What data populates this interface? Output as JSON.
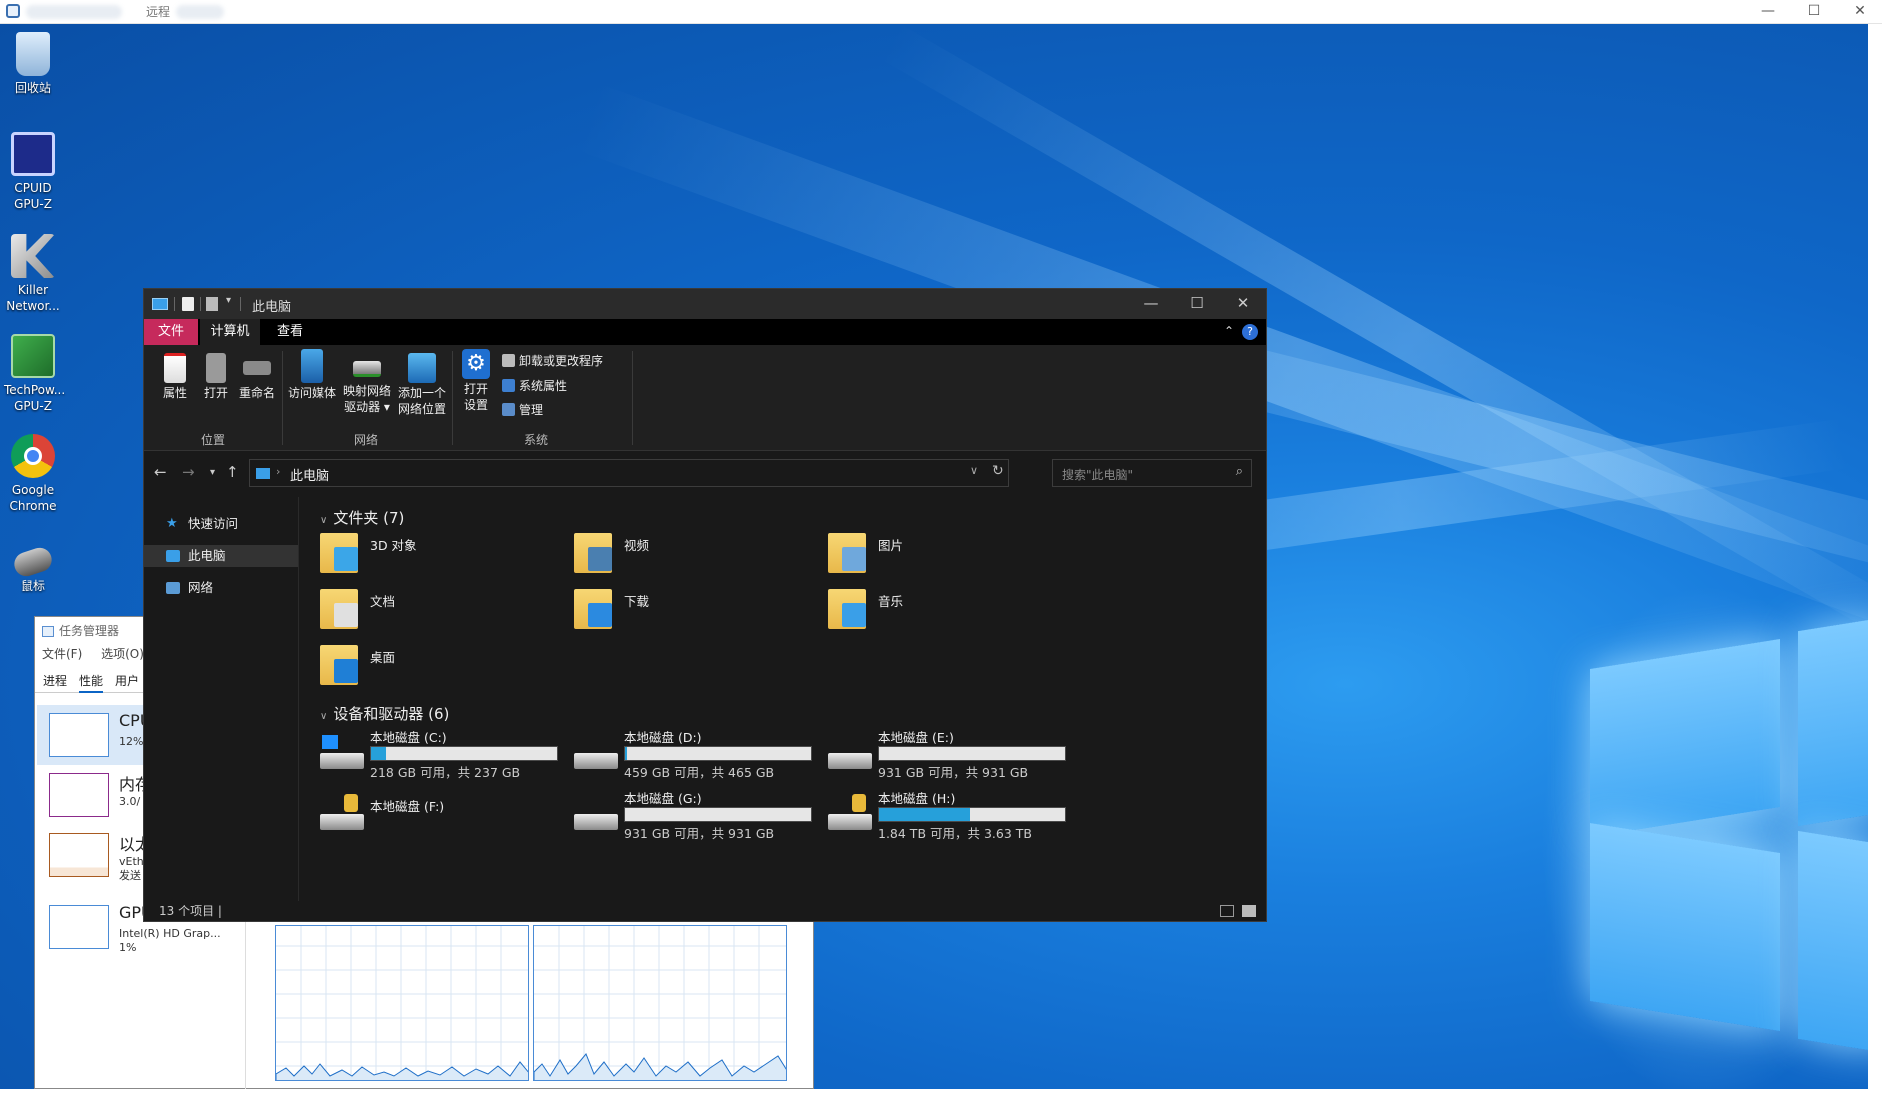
{
  "remote_window": {
    "title": "远程",
    "min": "—",
    "max": "☐",
    "close": "✕"
  },
  "desktop_icons": [
    {
      "label": "回收站"
    },
    {
      "label": "CPUID GPU-Z"
    },
    {
      "label": "Killer Networ..."
    },
    {
      "label": "TechPow... GPU-Z"
    },
    {
      "label": "Google Chrome"
    },
    {
      "label": "鼠标"
    }
  ],
  "task_manager": {
    "title": "任务管理器",
    "menu": [
      "文件(F)",
      "选项(O)"
    ],
    "tabs": [
      "进程",
      "性能",
      "用户"
    ],
    "items": [
      {
        "name": "CPU",
        "line1": "12%",
        "line2": ""
      },
      {
        "name": "内存",
        "line1": "3.0/",
        "line2": ""
      },
      {
        "name": "以太",
        "line1": "vEth",
        "line2": "发送"
      },
      {
        "name": "GPU",
        "line1": "Intel(R) HD Grap...",
        "line2": "1%"
      }
    ]
  },
  "explorer": {
    "title": "此电脑",
    "tabs": [
      "文件",
      "计算机",
      "查看"
    ],
    "ribbon": {
      "location": {
        "group": "位置",
        "properties": "属性",
        "open": "打开",
        "rename": "重命名"
      },
      "network": {
        "group": "网络",
        "media": "访问媒体",
        "map_drive_1": "映射网络",
        "map_drive_2": "驱动器 ▾",
        "add_loc_1": "添加一个",
        "add_loc_2": "网络位置"
      },
      "system": {
        "group": "系统",
        "settings_1": "打开",
        "settings_2": "设置",
        "uninstall": "卸载或更改程序",
        "sys_props": "系统属性",
        "manage": "管理"
      }
    },
    "address": {
      "crumb": "此电脑",
      "search_placeholder": "搜索\"此电脑\""
    },
    "nav": {
      "quick": "快速访问",
      "this_pc": "此电脑",
      "network": "网络"
    },
    "folders_header": "文件夹 (7)",
    "folders": [
      {
        "label": "3D 对象",
        "icon": "3d-objects"
      },
      {
        "label": "视频",
        "icon": "videos"
      },
      {
        "label": "图片",
        "icon": "pictures"
      },
      {
        "label": "文档",
        "icon": "documents"
      },
      {
        "label": "下载",
        "icon": "downloads"
      },
      {
        "label": "音乐",
        "icon": "music"
      },
      {
        "label": "桌面",
        "icon": "desktop"
      }
    ],
    "drives_header": "设备和驱动器 (6)",
    "drives": [
      {
        "name": "本地磁盘 (C:)",
        "free": "218 GB 可用，共 237 GB",
        "used_fraction": 0.08,
        "locked": false
      },
      {
        "name": "本地磁盘 (D:)",
        "free": "459 GB 可用，共 465 GB",
        "used_fraction": 0.01,
        "locked": false
      },
      {
        "name": "本地磁盘 (E:)",
        "free": "931 GB 可用，共 931 GB",
        "used_fraction": 0.0,
        "locked": false
      },
      {
        "name": "本地磁盘 (F:)",
        "free": "",
        "used_fraction": null,
        "locked": true
      },
      {
        "name": "本地磁盘 (G:)",
        "free": "931 GB 可用，共 931 GB",
        "used_fraction": 0.0,
        "locked": false
      },
      {
        "name": "本地磁盘 (H:)",
        "free": "1.84 TB 可用，共 3.63 TB",
        "used_fraction": 0.49,
        "locked": true
      }
    ],
    "status": "13 个项目  |",
    "colors": {
      "accent_file_tab": "#c62a5c",
      "drive_fill": "#26a0da",
      "background": "#191919"
    }
  }
}
